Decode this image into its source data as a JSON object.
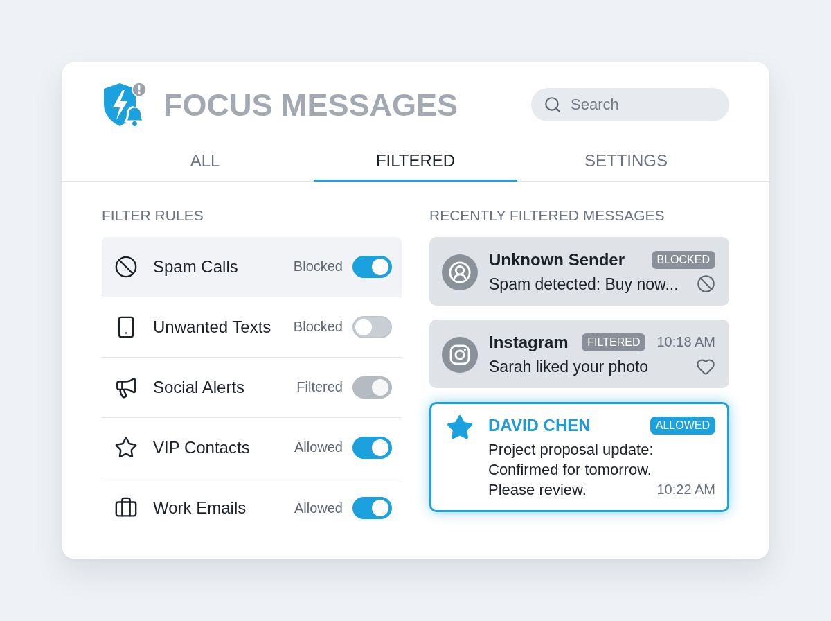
{
  "header": {
    "title": "FOCUS MESSAGES",
    "search": {
      "placeholder": "Search"
    }
  },
  "tabs": [
    {
      "label": "ALL",
      "selected": false
    },
    {
      "label": "FILTERED",
      "selected": true
    },
    {
      "label": "SETTINGS",
      "selected": false
    }
  ],
  "filter_rules": {
    "heading": "FILTER RULES",
    "rules": [
      {
        "label": "Spam Calls",
        "status": "Blocked",
        "on": true,
        "disabled": false,
        "selected": true
      },
      {
        "label": "Unwanted Texts",
        "status": "Blocked",
        "on": false,
        "disabled": false,
        "selected": false
      },
      {
        "label": "Social Alerts",
        "status": "Filtered",
        "on": true,
        "disabled": true,
        "selected": false
      },
      {
        "label": "VIP Contacts",
        "status": "Allowed",
        "on": true,
        "disabled": false,
        "selected": false
      },
      {
        "label": "Work Emails",
        "status": "Allowed",
        "on": true,
        "disabled": false,
        "selected": false
      }
    ]
  },
  "recent_messages": {
    "heading": "RECENTLY FILTERED MESSAGES",
    "messages": [
      {
        "kind": "blocked",
        "sender": "Unknown Sender",
        "badge": "BLOCKED",
        "text": "Spam detected: Buy now..."
      },
      {
        "kind": "filtered",
        "sender": "Instagram",
        "badge": "FILTERED",
        "time": "10:18 AM",
        "text": "Sarah liked your photo"
      },
      {
        "kind": "allowed",
        "sender": "DAVID CHEN",
        "badge": "ALLOWED",
        "text": "Project proposal update: Confirmed for tomorrow. Please review.",
        "time": "10:22 AM"
      }
    ]
  }
}
